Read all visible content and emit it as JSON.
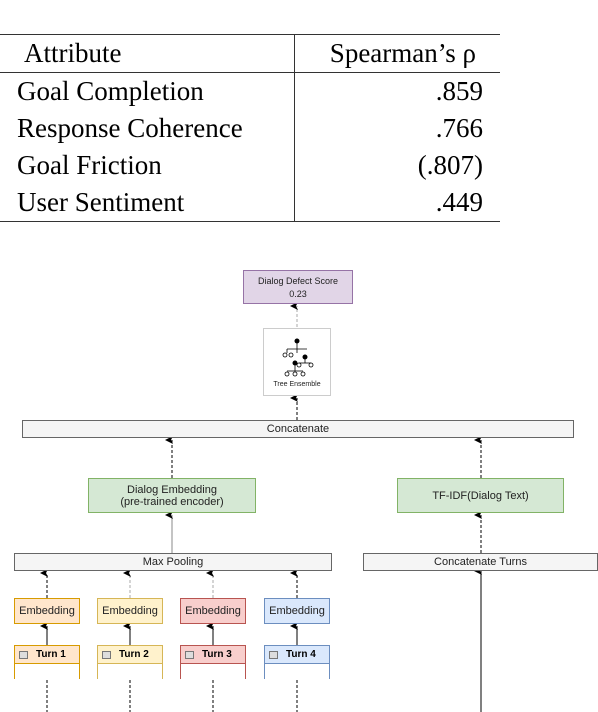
{
  "table": {
    "headers": [
      "Attribute",
      "Spearman’s ρ"
    ],
    "rows": [
      [
        "Goal Completion",
        ".859"
      ],
      [
        "Response Coherence",
        ".766"
      ],
      [
        "Goal Friction",
        "(.807)"
      ],
      [
        "User Sentiment",
        ".449"
      ]
    ]
  },
  "diagram": {
    "output": {
      "title": "Dialog Defect Score",
      "value": "0.23"
    },
    "model": {
      "label": "Tree Ensemble"
    },
    "concat": "Concatenate",
    "dialog_embedding": {
      "line1": "Dialog Embedding",
      "line2": "(pre-trained encoder)"
    },
    "tfidf": "TF-IDF(Dialog Text)",
    "max_pooling": "Max Pooling",
    "concat_turns": "Concatenate Turns",
    "embedding_label": "Embedding",
    "turns": [
      {
        "label": "Turn 1",
        "fill": "#ffe6cc",
        "stroke": "#d79b00"
      },
      {
        "label": "Turn 2",
        "fill": "#fff2cc",
        "stroke": "#d6b656"
      },
      {
        "label": "Turn 3",
        "fill": "#f8cecc",
        "stroke": "#b85450"
      },
      {
        "label": "Turn 4",
        "fill": "#dae8fc",
        "stroke": "#6c8ebf"
      }
    ]
  }
}
